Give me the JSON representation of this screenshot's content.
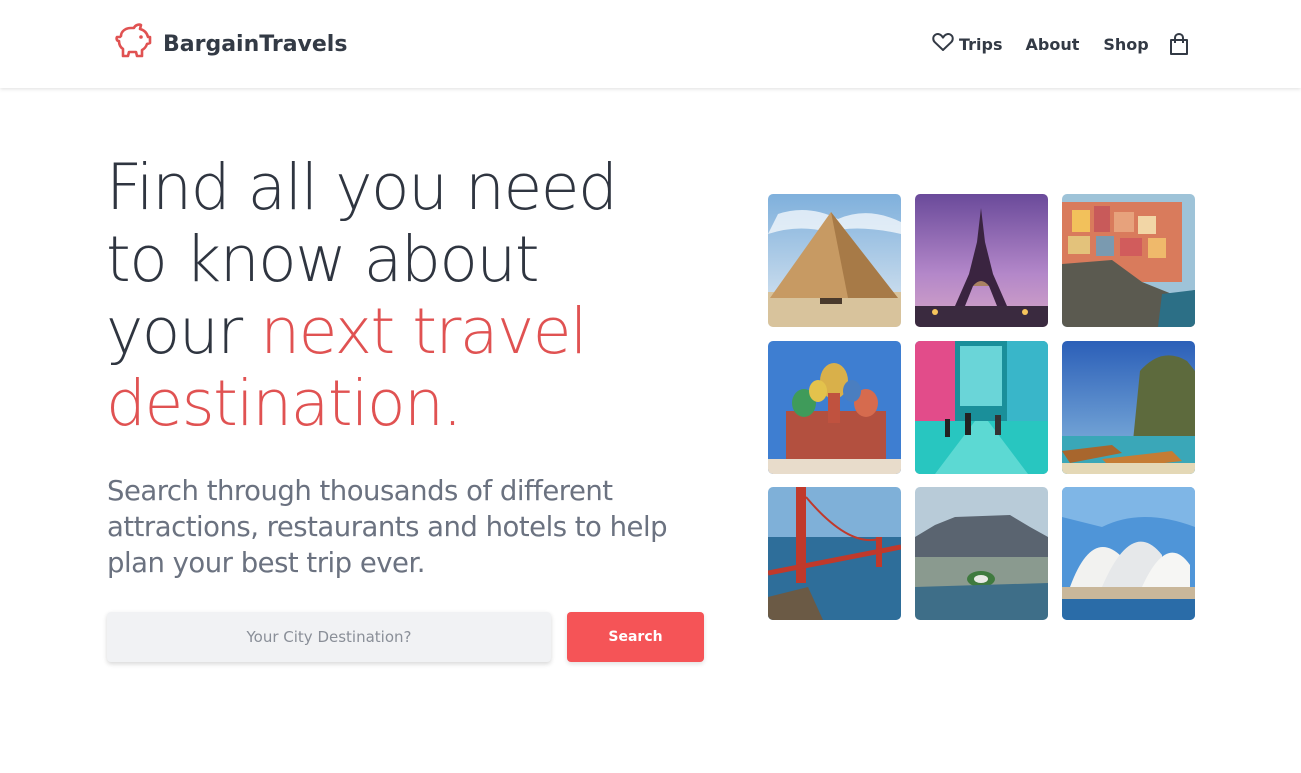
{
  "header": {
    "brand_name": "BargainTravels",
    "logo_icon": "piggy-bank-icon",
    "nav": {
      "trips_label": "Trips",
      "trips_icon": "heart-icon",
      "about_label": "About",
      "shop_label": "Shop",
      "cart_icon": "shopping-bag-icon"
    }
  },
  "hero": {
    "title_lines": [
      "Find all you need",
      "to know about"
    ],
    "title_line3_plain": "your ",
    "title_line3_accent": "next travel",
    "title_line4_accent": "destination.",
    "subtitle_lines": [
      "Search through thousands of different",
      "attractions, restaurants and hotels to help",
      "plan your best trip ever."
    ]
  },
  "search": {
    "placeholder": "Your City Destination?",
    "value": "",
    "button_label": "Search"
  },
  "gallery": {
    "images": [
      "pyramid-of-giza",
      "eiffel-tower",
      "cinque-terre-cliff-village",
      "st-basils-cathedral",
      "neon-city-street-crowd",
      "longtail-boats-limestone-cliff",
      "golden-gate-bridge",
      "table-mountain-cape-town",
      "sydney-opera-house"
    ]
  },
  "colors": {
    "accent": "#e05252",
    "button": "#f55457",
    "text_dark": "#2f3540",
    "text_muted": "#6b7280"
  }
}
